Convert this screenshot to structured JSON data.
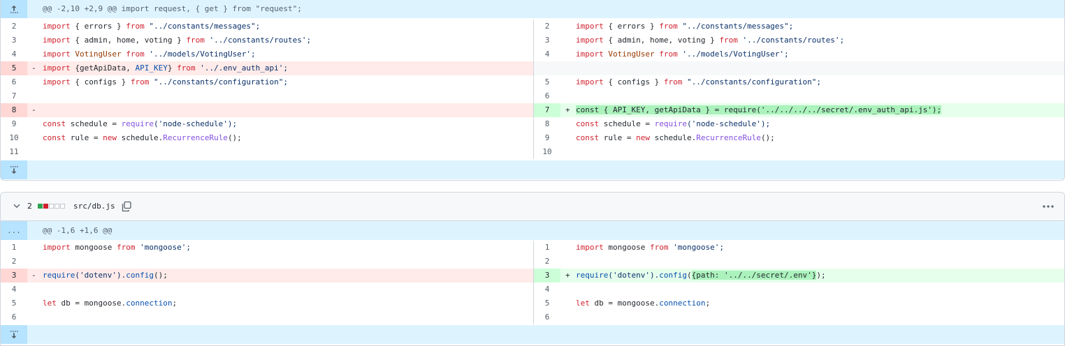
{
  "file1": {
    "hunk_header": "@@ -2,10 +2,9 @@ import request, { get } from \"request\";",
    "rows": [
      {
        "left_num": "2",
        "right_num": "2"
      },
      {
        "left_num": "3",
        "right_num": "3"
      },
      {
        "left_num": "4",
        "right_num": "4"
      },
      {
        "left_num": "5",
        "right_num": ""
      },
      {
        "left_num": "6",
        "right_num": "5"
      },
      {
        "left_num": "7",
        "right_num": "6"
      },
      {
        "left_num": "8",
        "right_num": "7"
      },
      {
        "left_num": "9",
        "right_num": "8"
      },
      {
        "left_num": "10",
        "right_num": "9"
      },
      {
        "left_num": "11",
        "right_num": "10"
      }
    ],
    "code": {
      "l2a": "import",
      "l2b": " { errors } ",
      "l2c": "from",
      "l2d": " \"../constants/messages\";",
      "l3a": "import",
      "l3b": " { admin, home, voting } ",
      "l3c": "from",
      "l3d": " '../constants/routes';",
      "l4a": "import",
      "l4b": " ",
      "l4c": "VotingUser",
      "l4d": " ",
      "l4e": "from",
      "l4f": " '../models/VotingUser';",
      "l5a": "import",
      "l5b": " {getApiData, ",
      "l5c": "API_KEY",
      "l5d": "} ",
      "l5e": "from",
      "l5f": " '../.env_auth_api';",
      "l6a": "import",
      "l6b": " { configs } ",
      "l6c": "from",
      "l6d": " \"../constants/configuration\";",
      "l9a": "const",
      "l9b": " schedule = ",
      "l9c": "require",
      "l9d": "('node-schedule');",
      "l10a": "const",
      "l10b": " rule = ",
      "l10c": "new",
      "l10d": " schedule.",
      "l10e": "RecurrenceRule",
      "l10f": "();",
      "r7": "const { API_KEY, getApiData } = require('../../../../secret/.env_auth_api.js');"
    }
  },
  "file2": {
    "changes_count": "2",
    "diffstat": [
      "add",
      "del",
      "neutral",
      "neutral",
      "neutral"
    ],
    "filename": "src/db.js",
    "expand_label": "...",
    "hunk_header": "@@ -1,6 +1,6 @@",
    "rows": [
      {
        "left_num": "1",
        "right_num": "1"
      },
      {
        "left_num": "2",
        "right_num": "2"
      },
      {
        "left_num": "3",
        "right_num": "3"
      },
      {
        "left_num": "4",
        "right_num": "4"
      },
      {
        "left_num": "5",
        "right_num": "5"
      },
      {
        "left_num": "6",
        "right_num": "6"
      }
    ],
    "code": {
      "m1a": "import",
      "m1b": " mongoose ",
      "m1c": "from",
      "m1d": " 'mongoose';",
      "m3a": "require",
      "m3b": "('dotenv').",
      "m3c": "config",
      "m3d": "();",
      "m3r_hl": "{path: '../../secret/.env'}",
      "m3r_end": ");",
      "m5a": "let",
      "m5b": " db = mongoose.",
      "m5c": "connection",
      "m5d": ";"
    }
  },
  "signs": {
    "minus": "-",
    "plus": "+"
  },
  "icons": {
    "expand_up": "expand-up-icon",
    "expand_down": "expand-down-icon",
    "chevron": "chevron-down-icon",
    "copy": "copy-icon",
    "kebab": "kebab-horizontal-icon"
  },
  "colors": {
    "hunk_bg": "#ddf4ff",
    "del_bg": "#ffebe9",
    "add_bg": "#e6ffec",
    "add_highlight": "#abf2bc"
  }
}
